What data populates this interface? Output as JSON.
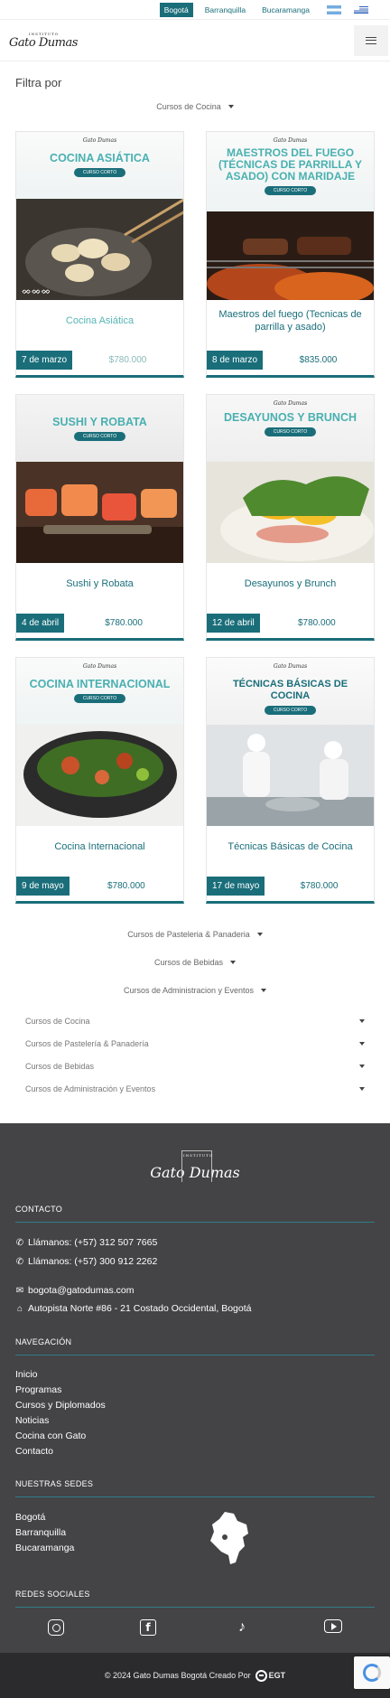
{
  "topbar": {
    "cities": [
      {
        "label": "Bogotá",
        "active": true
      },
      {
        "label": "Barranquilla",
        "active": false
      },
      {
        "label": "Bucaramanga",
        "active": false
      }
    ],
    "flags": [
      "argentina-flag-icon",
      "uruguay-flag-icon"
    ]
  },
  "header": {
    "logo_text": "Gato Dumas",
    "logo_small": "INSTITUTO",
    "menu_icon": "hamburger-menu-icon"
  },
  "filter": {
    "title": "Filtra por",
    "active_dropdown": "Cursos de Cocina"
  },
  "cards": [
    {
      "image_title": "COCINA ASIÁTICA",
      "image_pill": "CURSO CORTO",
      "name": "Cocina Asiática",
      "date": "7 de marzo",
      "price": "$780.000",
      "photo": "dumplings-photo",
      "name_style": "light",
      "price_style": "light"
    },
    {
      "image_title": "MAESTROS DEL FUEGO (TÉCNICAS DE PARRILLA Y ASADO) CON MARIDAJE",
      "image_pill": "CURSO CORTO",
      "name": "Maestros del fuego (Tecnicas de parrilla y asado)",
      "date": "8 de marzo",
      "price": "$835.000",
      "photo": "grill-photo",
      "name_style": "dark",
      "price_style": "dark"
    },
    {
      "image_title": "SUSHI Y ROBATA",
      "image_pill": "CURSO CORTO",
      "name": "Sushi y Robata",
      "date": "4 de abril",
      "price": "$780.000",
      "photo": "sushi-photo",
      "name_style": "dark",
      "price_style": "dark"
    },
    {
      "image_title": "DESAYUNOS Y BRUNCH",
      "image_pill": "CURSO CORTO",
      "name": "Desayunos y Brunch",
      "date": "12 de abril",
      "price": "$780.000",
      "photo": "brunch-photo",
      "name_style": "dark",
      "price_style": "dark"
    },
    {
      "image_title": "COCINA INTERNACIONAL",
      "image_pill": "CURSO CORTO",
      "name": "Cocina Internacional",
      "date": "9 de mayo",
      "price": "$780.000",
      "photo": "bowl-photo",
      "name_style": "dark",
      "price_style": "dark"
    },
    {
      "image_title": "TÉCNICAS BÁSICAS DE COCINA",
      "image_pill": "CURSO CORTO",
      "name": "Técnicas Básicas de Cocina",
      "date": "17 de mayo",
      "price": "$780.000",
      "photo": "chefs-photo",
      "name_style": "dark",
      "price_style": "dark"
    }
  ],
  "category_dropdowns": [
    "Cursos de Pasteleria & Panaderia",
    "Cursos de Bebidas",
    "Cursos de Administracion y Eventos"
  ],
  "accordion": [
    "Cursos de Cocina",
    "Cursos de Pastelería & Panadería",
    "Cursos de Bebidas",
    "Cursos de Administración y Eventos"
  ],
  "footer": {
    "logo_text": "Gato Dumas",
    "logo_small": "INSTITUTO",
    "contact_heading": "CONTACTO",
    "phone1": "Llámanos: (+57) 312 507 7665",
    "phone2": "Llámanos: (+57) 300 912 2262",
    "email": "bogota@gatodumas.com",
    "address": "Autopista Norte #86 - 21 Costado Occidental, Bogotá",
    "nav_heading": "NAVEGACIÓN",
    "nav_links": [
      "Inicio",
      "Programas",
      "Cursos y Diplomados",
      "Noticias",
      "Cocina con Gato",
      "Contacto"
    ],
    "sedes_heading": "NUESTRAS SEDES",
    "sedes": [
      "Bogotá",
      "Barranquilla",
      "Bucaramanga"
    ],
    "social_heading": "REDES SOCIALES",
    "social_icons": [
      "instagram-icon",
      "facebook-icon",
      "tiktok-icon",
      "youtube-icon"
    ]
  },
  "bottombar": {
    "copyright": "© 2024 Gato Dumas Bogotá Creado Por",
    "agency": "EGT"
  },
  "colors": {
    "brand": "#1a6e7a",
    "brand_light": "#4ab0b0",
    "footer_bg": "#444446",
    "bottom_bg": "#2b2b2d"
  }
}
